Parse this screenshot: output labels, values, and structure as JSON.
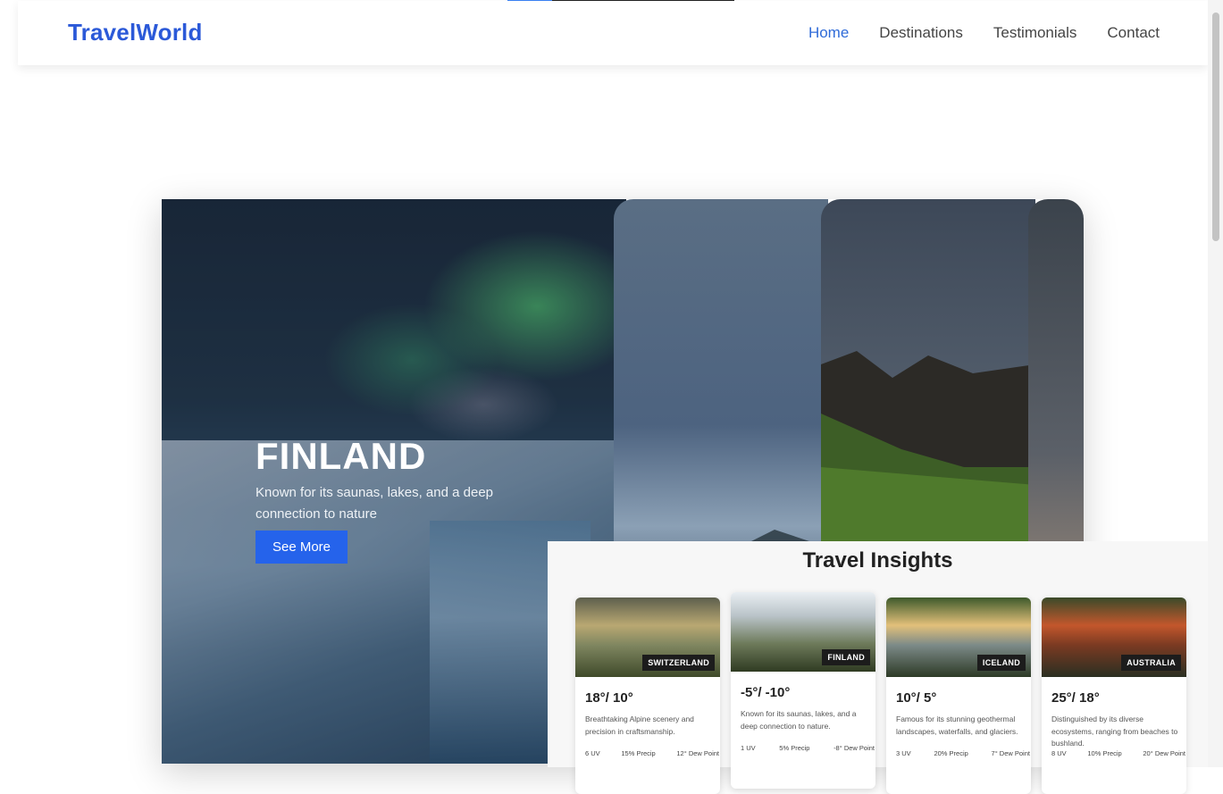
{
  "header": {
    "logo": "TravelWorld",
    "nav": [
      {
        "label": "Home",
        "active": true
      },
      {
        "label": "Destinations",
        "active": false
      },
      {
        "label": "Testimonials",
        "active": false
      },
      {
        "label": "Contact",
        "active": false
      }
    ]
  },
  "hero": {
    "title": "FINLAND",
    "description": "Known for its saunas, lakes, and a deep connection to nature",
    "button_label": "See More"
  },
  "insights": {
    "title": "Travel Insights",
    "cards": [
      {
        "badge": "SWITZERLAND",
        "temp": "18°/ 10°",
        "desc": "Breathtaking Alpine scenery and precision in craftsmanship.",
        "stats": [
          "6 UV",
          "15% Precip",
          "12° Dew Point"
        ]
      },
      {
        "badge": "FINLAND",
        "temp": "-5°/ -10°",
        "desc": "Known for its saunas, lakes, and a deep connection to nature.",
        "stats": [
          "1 UV",
          "5% Precip",
          "-8° Dew Point"
        ]
      },
      {
        "badge": "ICELAND",
        "temp": "10°/ 5°",
        "desc": "Famous for its stunning geothermal landscapes, waterfalls, and glaciers.",
        "stats": [
          "3 UV",
          "20% Precip",
          "7° Dew Point"
        ]
      },
      {
        "badge": "AUSTRALIA",
        "temp": "25°/ 18°",
        "desc": "Distinguished by its diverse ecosystems, ranging from beaches to bushland.",
        "stats": [
          "8 UV",
          "10% Precip",
          "20° Dew Point"
        ]
      }
    ]
  },
  "colors": {
    "brand": "#2b59d8",
    "button": "#2563eb",
    "badge": "#1c1c1c"
  }
}
